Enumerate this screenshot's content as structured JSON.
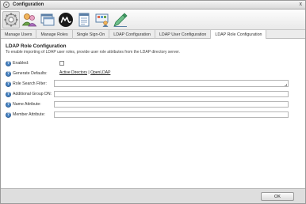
{
  "window": {
    "title": "Configuration",
    "close_label": "x"
  },
  "toolbar": {
    "icons": [
      "gear-icon",
      "users-icon",
      "window-icon",
      "m-logo-icon",
      "document-icon",
      "presentation-icon",
      "edit-icon"
    ],
    "active_index": 0
  },
  "tabs": [
    {
      "label": "Manage Users"
    },
    {
      "label": "Manage Roles"
    },
    {
      "label": "Single Sign-On"
    },
    {
      "label": "LDAP Configuration"
    },
    {
      "label": "LDAP User Configuration"
    },
    {
      "label": "LDAP Role Configuration"
    }
  ],
  "active_tab": "LDAP Role Configuration",
  "content": {
    "title": "LDAP Role Configuration",
    "description": "To enable importing of LDAP user roles, provide user role attributes from the LDAP directory server.",
    "enabled_label": "Enabled:",
    "generate_defaults_label": "Generate Defaults:",
    "defaults_links": {
      "active_directory": "Active Directory",
      "separator": "|",
      "openldap": "OpenLDAP"
    },
    "role_search_filter_label": "Role Search Filter:",
    "role_search_filter_value": "",
    "additional_group_dn_label": "Additional Group DN:",
    "additional_group_dn_value": "",
    "name_attribute_label": "Name Attribute:",
    "name_attribute_value": "",
    "member_attribute_label": "Member Attribute:",
    "member_attribute_value": "",
    "help_symbol": "?"
  },
  "footer": {
    "ok_label": "OK"
  }
}
